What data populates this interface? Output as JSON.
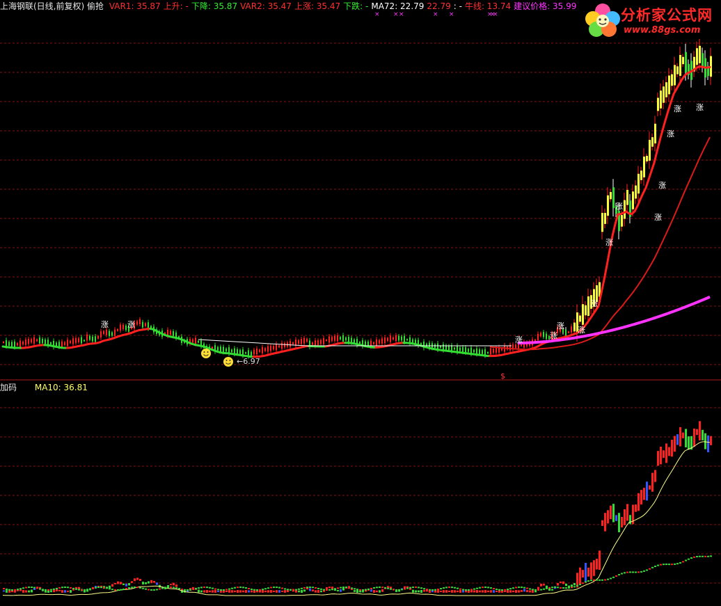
{
  "header": {
    "title": "上海钢联(日线,前复权) 偷抢",
    "indicators": [
      {
        "label": "VAR1: 35.87",
        "color": "#ff3030"
      },
      {
        "label": "上升: -",
        "color": "#ff3030"
      },
      {
        "label": "下降: 35.87",
        "color": "#33ee33"
      },
      {
        "label": "VAR2: 35.47",
        "color": "#ff3030"
      },
      {
        "label": "上涨: 35.47",
        "color": "#ff3030"
      },
      {
        "label": "下跌: -",
        "color": "#33ee33"
      },
      {
        "label": "MA72: 22.79",
        "color": "#ffffff"
      },
      {
        "label": "22.79",
        "color": "#ff3030"
      },
      {
        "label": ": -",
        "color": "#ffffff"
      },
      {
        "label": "牛线: 13.74",
        "color": "#ff3030"
      },
      {
        "label": "建议价格: 35.99",
        "color": "#ff33ff"
      }
    ]
  },
  "watermark": {
    "name": "分析家公式网",
    "url": "www.88gs.com"
  },
  "sub_panel": {
    "title": "加码",
    "indicator": "MA10: 36.81"
  },
  "annotations": {
    "low_price": "←6.97",
    "rise_mark": "涨",
    "dollar_mark": "$",
    "cross_mark": "×"
  },
  "colors": {
    "background": "#000000",
    "up": "#ff2020",
    "down": "#33dd33",
    "ma_yellow": "#ffff88",
    "magenta": "#ff33ff",
    "grid": "#8a1010"
  }
}
